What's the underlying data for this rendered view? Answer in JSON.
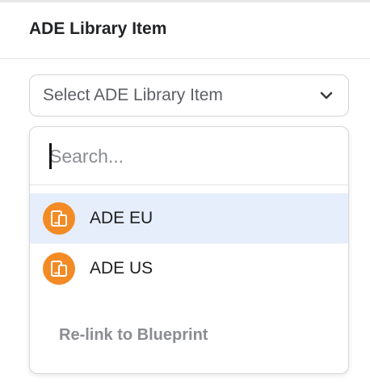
{
  "section": {
    "title": "ADE Library Item"
  },
  "select": {
    "value": "Select ADE Library Item",
    "chevron_icon": "chevron-down-icon"
  },
  "dropdown": {
    "search_placeholder": "Search...",
    "search_value": "",
    "options": [
      {
        "label": "ADE EU",
        "icon": "devices-icon",
        "highlighted": true
      },
      {
        "label": "ADE US",
        "icon": "devices-icon",
        "highlighted": false
      }
    ],
    "relink_label": "Re-link to Blueprint"
  },
  "colors": {
    "badge": "#f28b25",
    "highlight": "#e6eefb",
    "muted_text": "#8b8d91"
  }
}
